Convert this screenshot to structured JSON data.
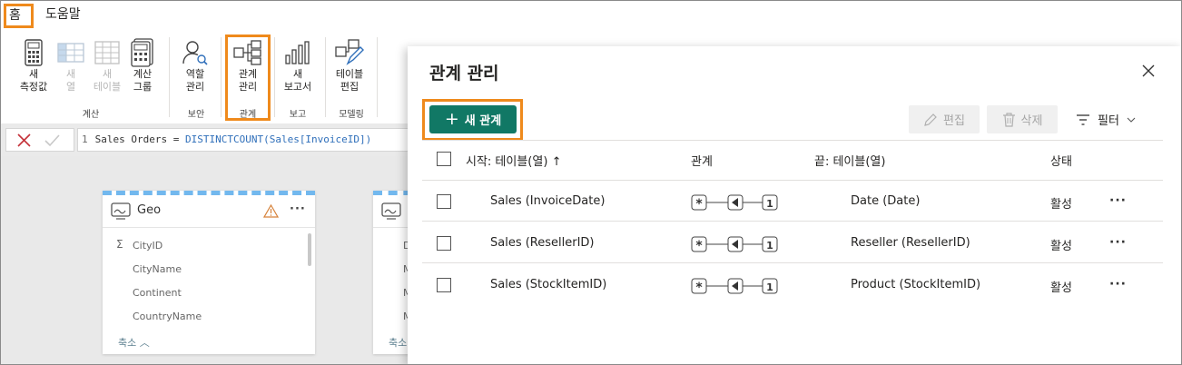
{
  "menu": {
    "tabs": [
      "홈",
      "도움말"
    ]
  },
  "ribbon": {
    "buttons": [
      {
        "line1": "새",
        "line2": "측정값"
      },
      {
        "line1": "새",
        "line2": "열"
      },
      {
        "line1": "새",
        "line2": "테이블"
      },
      {
        "line1": "계산",
        "line2": "그룹"
      },
      {
        "line1": "역할",
        "line2": "관리"
      },
      {
        "line1": "관계",
        "line2": "관리"
      },
      {
        "line1": "새",
        "line2": "보고서"
      },
      {
        "line1": "테이블",
        "line2": "편집"
      }
    ],
    "groups": [
      "계산",
      "보안",
      "관계",
      "보고",
      "모델링"
    ]
  },
  "formula": {
    "line_no": "1",
    "measure": "Sales Orders",
    "eq": "=",
    "func": "DISTINCTCOUNT",
    "arg": "(Sales[InvoiceID])"
  },
  "canvas": {
    "geo_table": {
      "name": "Geo",
      "fields": [
        "CityID",
        "CityName",
        "Continent",
        "CountryName"
      ],
      "collapse": "축소"
    },
    "second_table": {
      "field_initials": [
        "D",
        "M",
        "M",
        "M"
      ],
      "collapse": "축소"
    }
  },
  "dialog": {
    "title": "관계 관리",
    "new_button": "새 관계",
    "edit_button": "편집",
    "delete_button": "삭제",
    "filter_button": "필터",
    "columns": {
      "from": "시작: 테이블(열)",
      "relationship": "관계",
      "to": "끝: 테이블(열)",
      "status": "상태"
    },
    "rows": [
      {
        "from": "Sales (InvoiceDate)",
        "many": "*",
        "one": "1",
        "to": "Date (Date)",
        "status": "활성",
        "more": "···"
      },
      {
        "from": "Sales (ResellerID)",
        "many": "*",
        "one": "1",
        "to": "Reseller (ResellerID)",
        "status": "활성",
        "more": "···"
      },
      {
        "from": "Sales (StockItemID)",
        "many": "*",
        "one": "1",
        "to": "Product (StockItemID)",
        "status": "활성",
        "more": "···"
      }
    ]
  },
  "colors": {
    "accent": "#117865",
    "highlight": "#ef8a1c",
    "table_stripe": "#72b8ee"
  }
}
